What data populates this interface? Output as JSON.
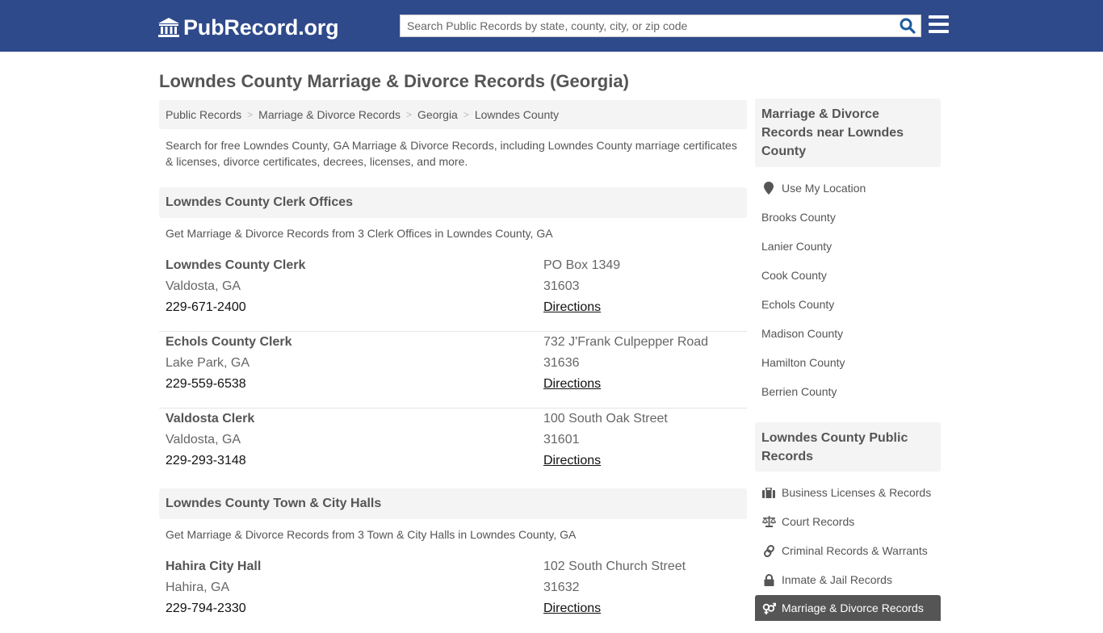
{
  "header": {
    "logo_text": "PubRecord.org",
    "logo_icon": "courthouse-icon",
    "search_placeholder": "Search Public Records by state, county, city, or zip code",
    "search_value": "",
    "brand_color": "#2e4a8b",
    "search_icon_color": "#1f5a9e"
  },
  "page": {
    "title": "Lowndes County Marriage & Divorce Records (Georgia)",
    "breadcrumb": [
      "Public Records",
      "Marriage & Divorce Records",
      "Georgia",
      "Lowndes County"
    ],
    "intro": "Search for free Lowndes County, GA Marriage & Divorce Records, including Lowndes County marriage certificates & licenses, divorce certificates, decrees, licenses, and more."
  },
  "sections": [
    {
      "title": "Lowndes County Clerk Offices",
      "subtitle": "Get Marriage & Divorce Records from 3 Clerk Offices in Lowndes County, GA",
      "items": [
        {
          "name": "Lowndes County Clerk",
          "city": "Valdosta, GA",
          "phone": "229-671-2400",
          "address": "PO Box 1349",
          "zip": "31603",
          "link": "Directions"
        },
        {
          "name": "Echols County Clerk",
          "city": "Lake Park, GA",
          "phone": "229-559-6538",
          "address": "732 J'Frank Culpepper Road",
          "zip": "31636",
          "link": "Directions"
        },
        {
          "name": "Valdosta Clerk",
          "city": "Valdosta, GA",
          "phone": "229-293-3148",
          "address": "100 South Oak Street",
          "zip": "31601",
          "link": "Directions"
        }
      ]
    },
    {
      "title": "Lowndes County Town & City Halls",
      "subtitle": "Get Marriage & Divorce Records from 3 Town & City Halls in Lowndes County, GA",
      "items": [
        {
          "name": "Hahira City Hall",
          "city": "Hahira, GA",
          "phone": "229-794-2330",
          "address": "102 South Church Street",
          "zip": "31632",
          "link": "Directions"
        }
      ]
    }
  ],
  "sidebar": {
    "nearby_title": "Marriage & Divorce Records near Lowndes County",
    "use_location": "Use My Location",
    "nearby": [
      "Brooks County",
      "Lanier County",
      "Cook County",
      "Echols County",
      "Madison County",
      "Hamilton County",
      "Berrien County"
    ],
    "public_title": "Lowndes County Public Records",
    "public_records": [
      {
        "label": "Business Licenses & Records",
        "icon": "briefcase-icon"
      },
      {
        "label": "Court Records",
        "icon": "scales-icon"
      },
      {
        "label": "Criminal Records & Warrants",
        "icon": "link-icon"
      },
      {
        "label": "Inmate & Jail Records",
        "icon": "lock-icon"
      },
      {
        "label": "Marriage & Divorce Records",
        "icon": "genders-icon",
        "active": true
      }
    ]
  }
}
